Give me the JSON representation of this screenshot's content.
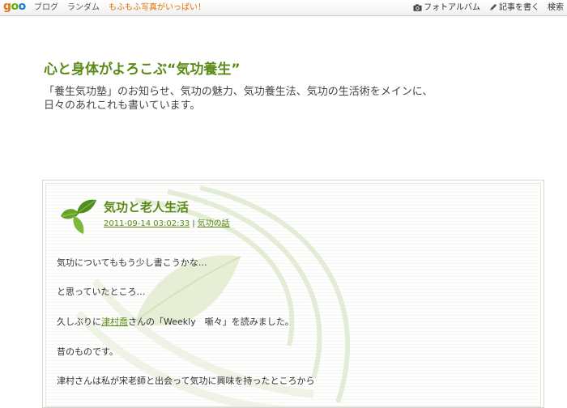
{
  "topbar": {
    "logo": {
      "g": "g",
      "o1": "o",
      "o2": "o"
    },
    "nav": [
      "ブログ",
      "ランダム"
    ],
    "promo": "もふもふ写真がいっぱい！",
    "right": {
      "photo_album": "フォトアルバム",
      "write": "記事を書く",
      "search": "検索"
    }
  },
  "header": {
    "title": "心と身体がよろこぶ“気功養生”",
    "description_line1": "「養生気功塾」のお知らせ、気功の魅力、気功養生法、気功の生活術をメインに、",
    "description_line2": "日々のあれこれも書いています。"
  },
  "post": {
    "title": "気功と老人生活",
    "date": "2011-09-14 03:02:33",
    "separator": "|",
    "category": "気功の話",
    "paragraphs": {
      "p1": "気功についてももう少し書こうかな…",
      "p2": "と思っていたところ…",
      "p3_before": "久しぶりに",
      "p3_link": "津村喬",
      "p3_after": "さんの「Weekly　噺々」を読みました。",
      "p4": "昔のものです。",
      "p5": "津村さんは私が宋老師と出会って気功に興味を持ったところから"
    }
  },
  "colors": {
    "accent_green": "#5a8a16",
    "promo_orange": "#e07000"
  },
  "icons": [
    "camera-icon",
    "pencil-icon",
    "leaf-icon"
  ]
}
